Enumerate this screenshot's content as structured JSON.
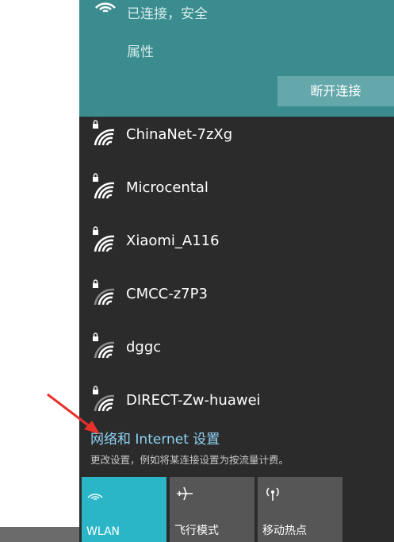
{
  "wifi_panel": {
    "connected": {
      "status": "已连接，安全",
      "properties_label": "属性",
      "disconnect_label": "断开连接"
    },
    "networks": [
      {
        "name": "ChinaNet-7zXg",
        "secured": true,
        "signal": "full"
      },
      {
        "name": "Microcental",
        "secured": true,
        "signal": "full"
      },
      {
        "name": "Xiaomi_A116",
        "secured": true,
        "signal": "full"
      },
      {
        "name": "CMCC-z7P3",
        "secured": true,
        "signal": "medium"
      },
      {
        "name": "dggc",
        "secured": true,
        "signal": "medium"
      },
      {
        "name": "DIRECT-Zw-huawei",
        "secured": true,
        "signal": "medium"
      }
    ],
    "settings_link": "网络和 Internet 设置",
    "settings_desc": "更改设置，例如将某连接设置为按流量计费。",
    "quick_actions": [
      {
        "label": "WLAN",
        "icon": "wifi-icon",
        "active": true
      },
      {
        "label": "飞行模式",
        "icon": "airplane-icon",
        "active": false
      },
      {
        "label": "移动热点",
        "icon": "hotspot-icon",
        "active": false
      }
    ]
  },
  "colors": {
    "panel_bg": "#2b2b2b",
    "connected_bg": "#3a8c8f",
    "disconnect_btn": "#64a8ab",
    "link": "#8fd3f5",
    "tile_active": "#2bb6c8",
    "tile_inactive": "#565656",
    "annotation_arrow": "#e8302a"
  }
}
